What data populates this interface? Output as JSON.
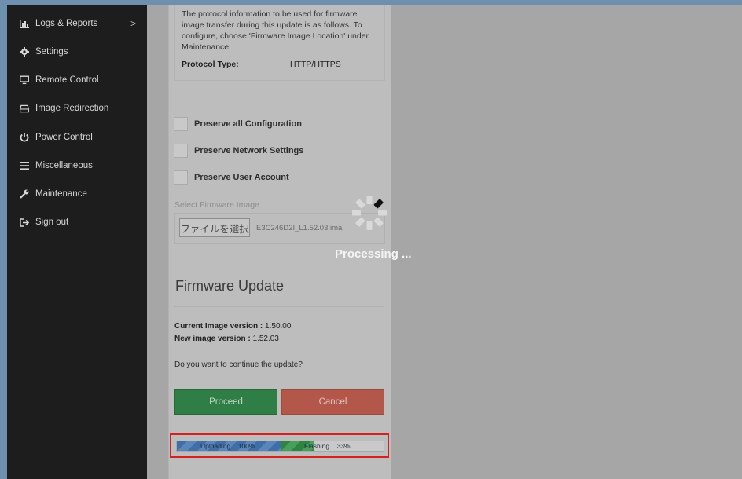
{
  "sidebar": {
    "items": [
      {
        "label": "Logs & Reports",
        "icon": "bar-chart-icon",
        "has_arrow": true,
        "arrow": ">"
      },
      {
        "label": "Settings",
        "icon": "gear-icon"
      },
      {
        "label": "Remote Control",
        "icon": "monitor-icon"
      },
      {
        "label": "Image Redirection",
        "icon": "drive-icon"
      },
      {
        "label": "Power Control",
        "icon": "power-icon"
      },
      {
        "label": "Miscellaneous",
        "icon": "menu-icon"
      },
      {
        "label": "Maintenance",
        "icon": "wrench-icon"
      },
      {
        "label": "Sign out",
        "icon": "sign-out-icon"
      }
    ]
  },
  "protocol_info": {
    "text": "The protocol information to be used for firmware image transfer during this update is as follows. To configure, choose 'Firmware Image Location' under Maintenance.",
    "protocol_label": "Protocol Type:",
    "protocol_value": "HTTP/HTTPS"
  },
  "options": [
    {
      "label": "Preserve all Configuration",
      "checked": false
    },
    {
      "label": "Preserve Network Settings",
      "checked": false
    },
    {
      "label": "Preserve User Account",
      "checked": false
    }
  ],
  "firmware_select": {
    "label": "Select Firmware Image",
    "button_label": "ファイルを選択",
    "file_name": "E3C246D2I_L1.52.03.ima"
  },
  "firmware_update": {
    "title": "Firmware Update",
    "current_label": "Current Image version :",
    "current_value": "1.50.00",
    "new_label": "New image version :",
    "new_value": "1.52.03",
    "question": "Do you want to continue the update?",
    "proceed_label": "Proceed",
    "cancel_label": "Cancel"
  },
  "progress": {
    "upload_text": "Uploading... 100%",
    "upload_fraction": 1.0,
    "flash_text": "Flashing... 33%",
    "flash_fraction": 0.33
  },
  "overlay": {
    "text": "Processing ..."
  },
  "colors": {
    "proceed": "#2e7e45",
    "cancel": "#b4574b",
    "highlight_border": "#d52020",
    "sidebar_bg": "#1d1d1d"
  }
}
